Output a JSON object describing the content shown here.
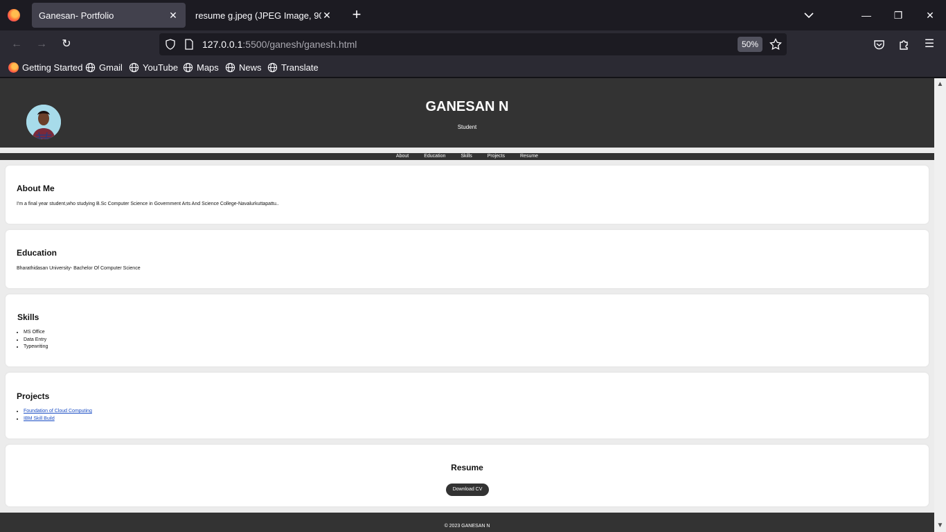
{
  "browser": {
    "tabs": [
      {
        "title": "Ganesan- Portfolio",
        "active": true
      },
      {
        "title": "resume g.jpeg (JPEG Image, 904 × 1",
        "active": false
      }
    ],
    "url_host": "127.0.0.1",
    "url_rest": ":5500/ganesh/ganesh.html",
    "zoom": "50%",
    "bookmarks": [
      "Getting Started",
      "Gmail",
      "YouTube",
      "Maps",
      "News",
      "Translate"
    ]
  },
  "site": {
    "title": "GANESAN N",
    "subtitle": "Student",
    "nav": [
      "About",
      "Education",
      "Skills",
      "Projects",
      "Resume"
    ],
    "about": {
      "heading": "About Me",
      "text": "I'm a final year student,who studying B.Sc Computer Science in Government Arts And Science College-Navalurkuttapattu.."
    },
    "education": {
      "heading": "Education",
      "text": "Bharathidasan University- Bachelor Of Computer Science"
    },
    "skills": {
      "heading": "Skills",
      "items": [
        "MS Office",
        "Data Entry",
        "Typewriting"
      ]
    },
    "projects": {
      "heading": "Projects",
      "items": [
        "Foundation of Cloud Computing",
        "IBM Skill Build"
      ]
    },
    "resume": {
      "heading": "Resume",
      "button": "Download CV"
    },
    "footer": "© 2023 GANESAN N"
  }
}
